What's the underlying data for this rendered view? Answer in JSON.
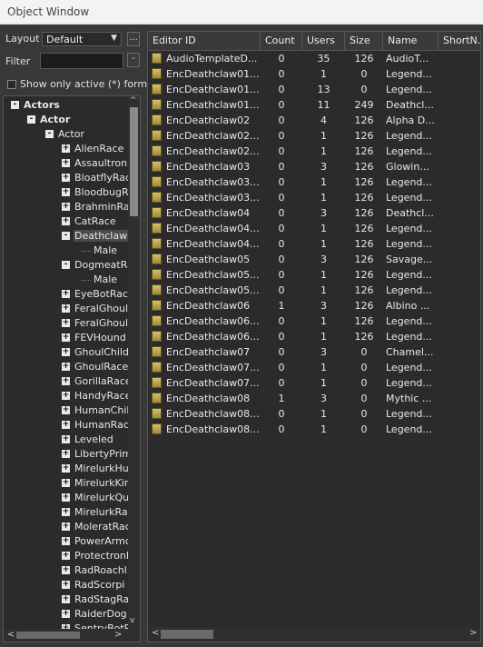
{
  "window": {
    "title": "Object Window"
  },
  "controls": {
    "layout_label": "Layout",
    "layout_value": "Default",
    "layout_btn": "...",
    "filter_label": "Filter",
    "filter_value": "",
    "filter_btn": "-",
    "show_active_label": "Show only active (*) forms"
  },
  "tree": {
    "root": "Actors",
    "actor": "Actor",
    "subactor": "Actor",
    "items": [
      "AlienRace",
      "Assaultron",
      "BloatflyRac",
      "BloodbugR",
      "BrahminRa",
      "CatRace",
      "Deathclawl",
      "Male",
      "DogmeatRa",
      "Male",
      "EyeBotRace",
      "FeralGhoul",
      "FeralGhoul",
      "FEVHound",
      "GhoulChild",
      "GhoulRace",
      "GorillaRace",
      "HandyRace",
      "HumanChil",
      "HumanRac",
      "Leveled",
      "LibertyPrim",
      "MirelurkHu",
      "MirelurkKir",
      "MirelurkQu",
      "MirelurkRa",
      "MoleratRac",
      "PowerArmo",
      "ProtectronI",
      "RadRoachl",
      "RadScorpi",
      "RadStagRa",
      "RaiderDog",
      "SentryBotR"
    ]
  },
  "list": {
    "columns": [
      "Editor ID",
      "Count",
      "Users",
      "Size",
      "Name",
      "ShortN..."
    ],
    "rows": [
      {
        "id": "AudioTemplateD...",
        "count": "0",
        "users": "35",
        "size": "126",
        "name": "AudioT..."
      },
      {
        "id": "EncDeathclaw01...",
        "count": "0",
        "users": "1",
        "size": "0",
        "name": "Legend..."
      },
      {
        "id": "EncDeathclaw01...",
        "count": "0",
        "users": "13",
        "size": "0",
        "name": "Legend..."
      },
      {
        "id": "EncDeathclaw01...",
        "count": "0",
        "users": "11",
        "size": "249",
        "name": "Deathcl..."
      },
      {
        "id": "EncDeathclaw02",
        "count": "0",
        "users": "4",
        "size": "126",
        "name": "Alpha D..."
      },
      {
        "id": "EncDeathclaw02...",
        "count": "0",
        "users": "1",
        "size": "126",
        "name": "Legend..."
      },
      {
        "id": "EncDeathclaw02...",
        "count": "0",
        "users": "1",
        "size": "126",
        "name": "Legend..."
      },
      {
        "id": "EncDeathclaw03",
        "count": "0",
        "users": "3",
        "size": "126",
        "name": "Glowin..."
      },
      {
        "id": "EncDeathclaw03...",
        "count": "0",
        "users": "1",
        "size": "126",
        "name": "Legend..."
      },
      {
        "id": "EncDeathclaw03...",
        "count": "0",
        "users": "1",
        "size": "126",
        "name": "Legend..."
      },
      {
        "id": "EncDeathclaw04",
        "count": "0",
        "users": "3",
        "size": "126",
        "name": "Deathcl..."
      },
      {
        "id": "EncDeathclaw04...",
        "count": "0",
        "users": "1",
        "size": "126",
        "name": "Legend..."
      },
      {
        "id": "EncDeathclaw04...",
        "count": "0",
        "users": "1",
        "size": "126",
        "name": "Legend..."
      },
      {
        "id": "EncDeathclaw05",
        "count": "0",
        "users": "3",
        "size": "126",
        "name": "Savage..."
      },
      {
        "id": "EncDeathclaw05...",
        "count": "0",
        "users": "1",
        "size": "126",
        "name": "Legend..."
      },
      {
        "id": "EncDeathclaw05...",
        "count": "0",
        "users": "1",
        "size": "126",
        "name": "Legend..."
      },
      {
        "id": "EncDeathclaw06",
        "count": "1",
        "users": "3",
        "size": "126",
        "name": "Albino ..."
      },
      {
        "id": "EncDeathclaw06...",
        "count": "0",
        "users": "1",
        "size": "126",
        "name": "Legend..."
      },
      {
        "id": "EncDeathclaw06...",
        "count": "0",
        "users": "1",
        "size": "126",
        "name": "Legend..."
      },
      {
        "id": "EncDeathclaw07",
        "count": "0",
        "users": "3",
        "size": "0",
        "name": "Chamel..."
      },
      {
        "id": "EncDeathclaw07...",
        "count": "0",
        "users": "1",
        "size": "0",
        "name": "Legend..."
      },
      {
        "id": "EncDeathclaw07...",
        "count": "0",
        "users": "1",
        "size": "0",
        "name": "Legend..."
      },
      {
        "id": "EncDeathclaw08",
        "count": "1",
        "users": "3",
        "size": "0",
        "name": "Mythic ..."
      },
      {
        "id": "EncDeathclaw08...",
        "count": "0",
        "users": "1",
        "size": "0",
        "name": "Legend..."
      },
      {
        "id": "EncDeathclaw08...",
        "count": "0",
        "users": "1",
        "size": "0",
        "name": "Legend..."
      }
    ]
  },
  "icons": {
    "expand": "+",
    "collapse": "-",
    "scroll_left": "<",
    "scroll_right": ">",
    "scroll_up": "^",
    "scroll_down": "v"
  }
}
